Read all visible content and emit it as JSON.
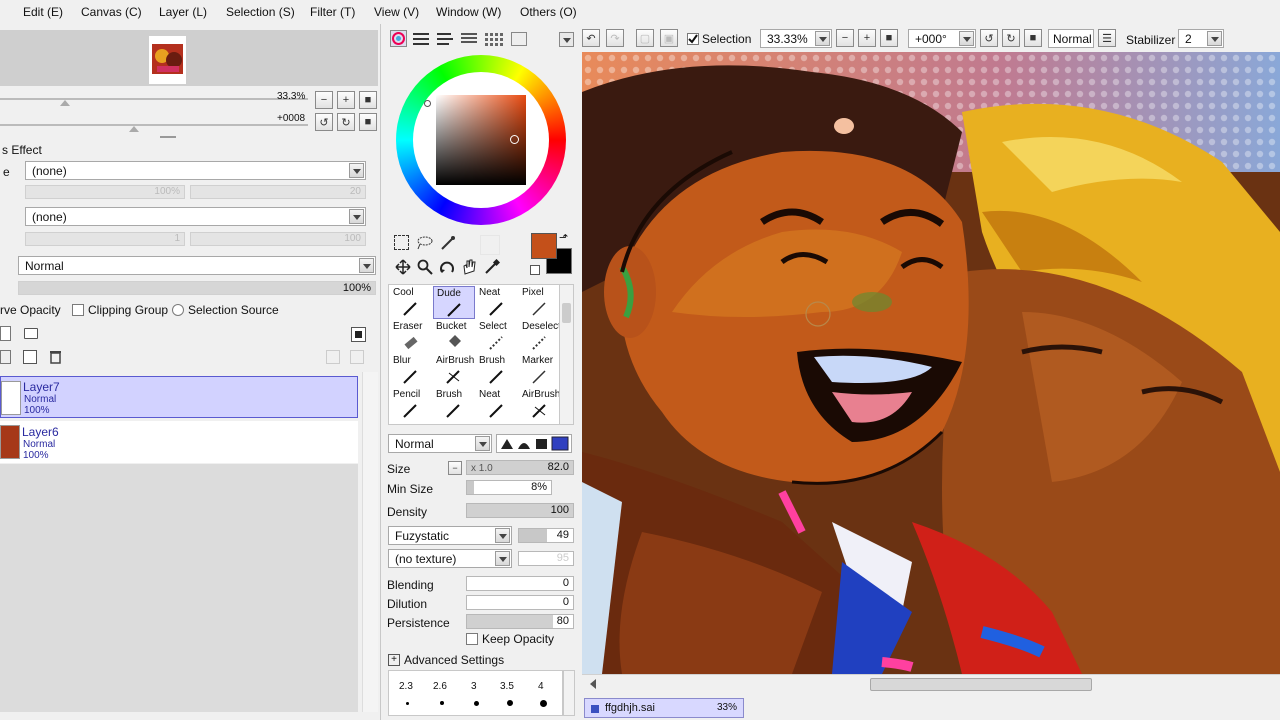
{
  "menubar": {
    "items": [
      "Edit (E)",
      "Canvas (C)",
      "Layer (L)",
      "Selection (S)",
      "Filter (T)",
      "View (V)",
      "Window (W)",
      "Others (O)"
    ]
  },
  "navigator": {
    "zoom": "33.3%",
    "rotation": "+0008"
  },
  "layer_effect": {
    "title": "s Effect",
    "texture_label": "e",
    "texture_value": "(none)",
    "texture_pct": "100%",
    "texture_num": "20",
    "effect_value": "(none)",
    "effect_num1": "1",
    "effect_num2": "100"
  },
  "layer_props": {
    "mode": "Normal",
    "opacity": "100%",
    "preserve_opacity": "rve Opacity",
    "clipping_group": "Clipping Group",
    "selection_source": "Selection Source"
  },
  "layers": [
    {
      "name": "Layer7",
      "mode": "Normal",
      "opacity": "100%",
      "selected": true
    },
    {
      "name": "Layer6",
      "mode": "Normal",
      "opacity": "100%",
      "selected": false
    }
  ],
  "colors": {
    "foreground": "#c4501a",
    "background": "#000000"
  },
  "tools": [
    {
      "label": "Cool"
    },
    {
      "label": "Dude"
    },
    {
      "label": "Neat"
    },
    {
      "label": "Pixel"
    },
    {
      "label": "Eraser"
    },
    {
      "label": "Bucket"
    },
    {
      "label": "Select"
    },
    {
      "label": "Deselect"
    },
    {
      "label": "Blur"
    },
    {
      "label": "AirBrush"
    },
    {
      "label": "Brush"
    },
    {
      "label": "Marker"
    },
    {
      "label": "Pencil"
    },
    {
      "label": "Brush"
    },
    {
      "label": "Neat"
    },
    {
      "label": "AirBrush"
    }
  ],
  "brush": {
    "mode": "Normal",
    "size_label": "Size",
    "size_mult": "x 1.0",
    "size_value": "82.0",
    "min_size_label": "Min Size",
    "min_size_value": "8%",
    "density_label": "Density",
    "density_value": "100",
    "shape": "Fuzystatic",
    "shape_value": "49",
    "texture": "(no texture)",
    "texture_value": "95",
    "blending_label": "Blending",
    "blending_value": "0",
    "dilution_label": "Dilution",
    "dilution_value": "0",
    "persistence_label": "Persistence",
    "persistence_value": "80",
    "keep_opacity": "Keep Opacity",
    "advanced": "Advanced Settings",
    "dot_sizes": [
      "2.3",
      "2.6",
      "3",
      "3.5",
      "4"
    ]
  },
  "canvas_toolbar": {
    "selection_label": "Selection",
    "zoom": "33.33%",
    "rotation": "+000°",
    "blend_mode": "Normal",
    "stabilizer_label": "Stabilizer",
    "stabilizer_value": "2"
  },
  "status": {
    "file_name": "ffgdhjh.sai",
    "file_zoom": "33%"
  }
}
